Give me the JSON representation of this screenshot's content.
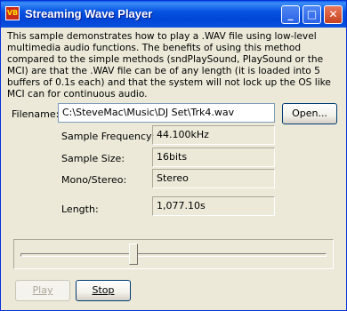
{
  "window": {
    "title": "Streaming Wave Player",
    "icon": "vb-app-icon",
    "icon_text": "VB",
    "buttons": {
      "minimize": "_",
      "maximize": "□",
      "close": "✕"
    }
  },
  "description": "This sample demonstrates how to play a .WAV file using low-level multimedia audio functions.  The benefits of using this method compared to the simple methods (sndPlaySound, PlaySound or the MCI) are that the .WAV file can be of any length (it is loaded into 5 buffers of 0.1s each) and that the system will not lock up the OS like MCI can for continuous audio.",
  "filename": {
    "label": "Filename:",
    "value": "C:\\SteveMac\\Music\\DJ Set\\Trk4.wav",
    "open_button": "Open..."
  },
  "info": {
    "sample_frequency": {
      "label": "Sample Frequency:",
      "value": "44.100kHz"
    },
    "sample_size": {
      "label": "Sample Size:",
      "value": "16bits"
    },
    "mono_stereo": {
      "label": "Mono/Stereo:",
      "value": "Stereo"
    },
    "length": {
      "label": "Length:",
      "value": "1,077.10s"
    }
  },
  "position_slider": {
    "fraction": 0.37
  },
  "controls": {
    "play": {
      "label": "Play",
      "enabled": false
    },
    "stop": {
      "label": "Stop",
      "enabled": true
    }
  }
}
